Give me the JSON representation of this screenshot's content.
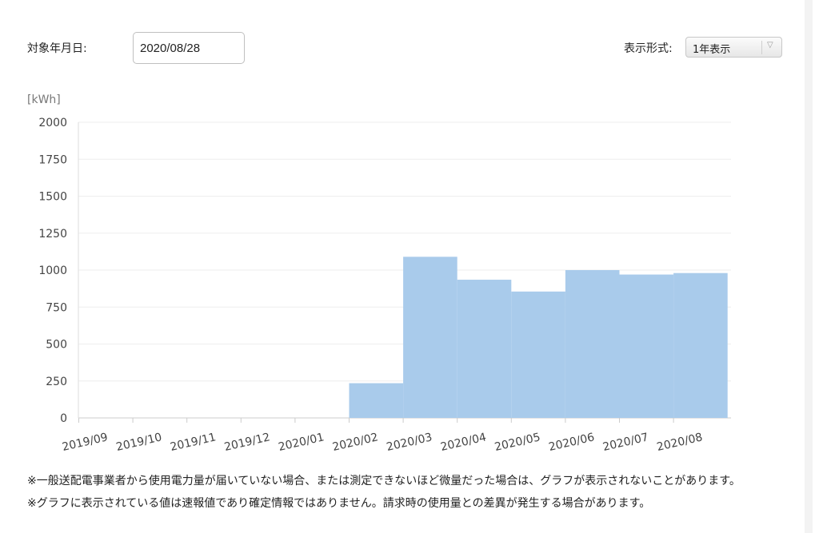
{
  "header": {
    "date_label": "対象年月日:",
    "date_value": "2020/08/28",
    "format_label": "表示形式:",
    "format_value": "1年表示"
  },
  "chart_data": {
    "type": "bar",
    "ylabel": "[kWh]",
    "ylim": [
      0,
      2000
    ],
    "yticks": [
      0,
      250,
      500,
      750,
      1000,
      1250,
      1500,
      1750,
      2000
    ],
    "categories": [
      "2019/09",
      "2019/10",
      "2019/11",
      "2019/12",
      "2020/01",
      "2020/02",
      "2020/03",
      "2020/04",
      "2020/05",
      "2020/06",
      "2020/07",
      "2020/08"
    ],
    "values": [
      0,
      0,
      0,
      0,
      0,
      235,
      1090,
      935,
      855,
      1000,
      970,
      980
    ],
    "grid": true,
    "bar_color": "#a9cbeb"
  },
  "notes": [
    "※一般送配電事業者から使用電力量が届いていない場合、または測定できないほど微量だった場合は、グラフが表示されないことがあります。",
    "※グラフに表示されている値は速報値であり確定情報ではありません。請求時の使用量との差異が発生する場合があります。"
  ]
}
